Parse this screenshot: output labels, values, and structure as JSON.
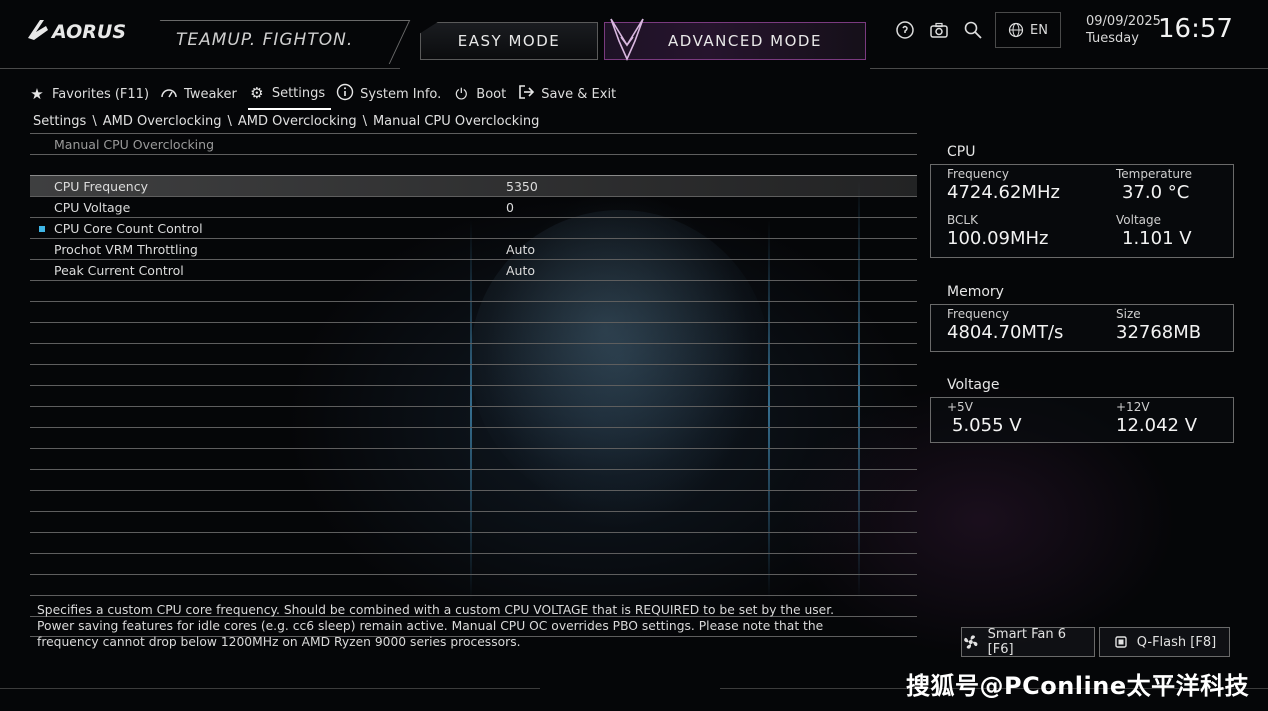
{
  "header": {
    "brand": "AORUS",
    "tagline": "TEAMUP. FIGHTON.",
    "easy_mode_label": "EASY MODE",
    "advanced_mode_label": "ADVANCED MODE",
    "language": "EN",
    "date": "09/09/2025",
    "weekday": "Tuesday",
    "time": "16:57"
  },
  "menu": [
    {
      "label": "Favorites (F11)",
      "icon": "star-icon"
    },
    {
      "label": "Tweaker",
      "icon": "speedometer-icon"
    },
    {
      "label": "Settings",
      "icon": "gear-icon",
      "active": true
    },
    {
      "label": "System Info.",
      "icon": "info-icon"
    },
    {
      "label": "Boot",
      "icon": "power-icon"
    },
    {
      "label": "Save & Exit",
      "icon": "exit-icon"
    }
  ],
  "breadcrumb": [
    "Settings",
    "AMD Overclocking",
    "AMD Overclocking",
    "Manual CPU Overclocking"
  ],
  "table": {
    "section_title": "Manual CPU Overclocking",
    "rows": [
      {
        "label": "CPU Frequency",
        "value": "5350"
      },
      {
        "label": "CPU Voltage",
        "value": "0"
      },
      {
        "label": "CPU Core Count Control",
        "value": ""
      },
      {
        "label": "Prochot VRM Throttling",
        "value": "Auto"
      },
      {
        "label": "Peak Current Control",
        "value": "Auto"
      }
    ]
  },
  "cpu": {
    "title": "CPU",
    "frequency_label": "Frequency",
    "frequency": "4724.62MHz",
    "temperature_label": "Temperature",
    "temperature": "37.0 °C",
    "bclk_label": "BCLK",
    "bclk": "100.09MHz",
    "voltage_label": "Voltage",
    "voltage": "1.101 V"
  },
  "memory": {
    "title": "Memory",
    "frequency_label": "Frequency",
    "frequency": "4804.70MT/s",
    "size_label": "Size",
    "size": "32768MB"
  },
  "voltage": {
    "title": "Voltage",
    "v5_label": "+5V",
    "v5": "5.055 V",
    "v12_label": "+12V",
    "v12": "12.042 V"
  },
  "help_text": "Specifies a custom CPU core frequency. Should be combined with a custom CPU VOLTAGE that is REQUIRED to be set by the user. Power saving features for idle cores (e.g. cc6 sleep) remain active. Manual CPU OC overrides PBO settings. Please note that the frequency cannot drop below 1200MHz on AMD Ryzen 9000 series processors.",
  "footer": {
    "smart_fan_label": "Smart Fan 6 [F6]",
    "qflash_label": "Q-Flash [F8]"
  },
  "watermark": "搜狐号@PConline太平洋科技"
}
